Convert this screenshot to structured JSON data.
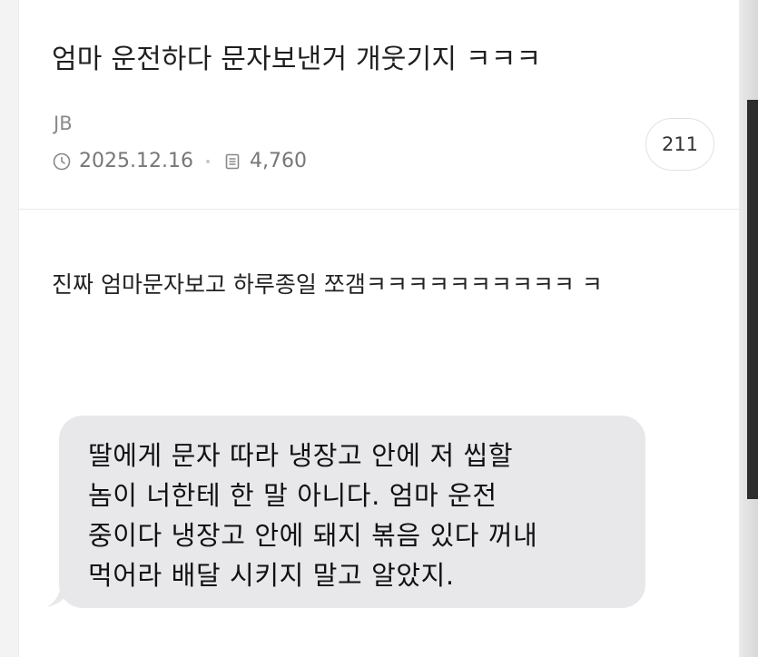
{
  "post": {
    "title": "엄마 운전하다 문자보낸거 개웃기지 ㅋㅋㅋ",
    "author": "JB",
    "date": "2025.12.16",
    "views": "4,760",
    "comment_count": "211",
    "body": "진짜 엄마문자보고 하루종일 쪼갬ㅋㅋㅋㅋㅋㅋㅋㅋㅋㅋ ㅋ"
  },
  "message": {
    "text": "딸에게 문자 따라 냉장고 안에 저 씹할\n놈이 너한테 한 말 아니다. 엄마 운전\n중이다 냉장고 안에 돼지 볶음 있다 꺼내\n먹어라 배달 시키지 말고 알았지."
  },
  "icons": {
    "date": "clock-icon",
    "views": "document-icon"
  },
  "colors": {
    "bubble": "#e8e8eb",
    "meta_text": "#777777"
  }
}
